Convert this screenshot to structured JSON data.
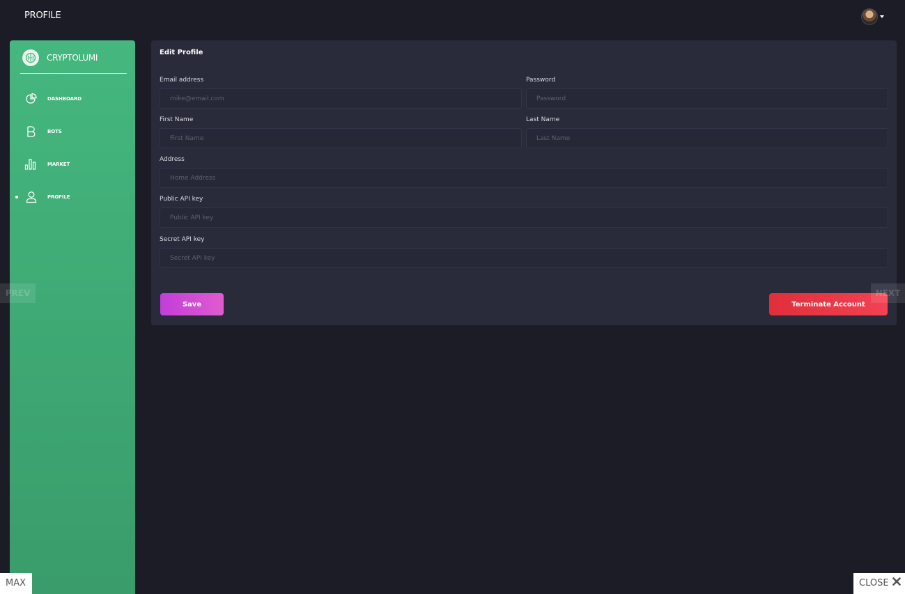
{
  "header": {
    "title": "PROFILE",
    "avatar_icon": "user-avatar-icon"
  },
  "sidebar": {
    "brand_name": "CRYPTOLUMI",
    "brand_icon": "brain-icon",
    "items": [
      {
        "label": "DASHBOARD",
        "icon": "pie-chart-icon",
        "active": false
      },
      {
        "label": "BOTS",
        "icon": "bitcoin-b-icon",
        "active": false
      },
      {
        "label": "MARKET",
        "icon": "bar-chart-icon",
        "active": false
      },
      {
        "label": "PROFILE",
        "icon": "user-icon",
        "active": true
      }
    ]
  },
  "form": {
    "title": "Edit Profile",
    "email": {
      "label": "Email address",
      "placeholder": "mike@email.com",
      "value": ""
    },
    "password": {
      "label": "Password",
      "placeholder": "Password",
      "value": ""
    },
    "first_name": {
      "label": "First Name",
      "placeholder": "First Name",
      "value": ""
    },
    "last_name": {
      "label": "Last Name",
      "placeholder": "Last Name",
      "value": ""
    },
    "address": {
      "label": "Address",
      "placeholder": "Home Address",
      "value": ""
    },
    "public_api_key": {
      "label": "Public API key",
      "placeholder": "Public API key",
      "value": ""
    },
    "secret_api_key": {
      "label": "Secret API key",
      "placeholder": "Secret API key",
      "value": ""
    },
    "save_label": "Save",
    "terminate_label": "Terminate Account"
  },
  "viewer": {
    "prev_label": "PREV",
    "next_label": "NEXT",
    "max_label": "MAX",
    "close_label": "CLOSE",
    "close_icon": "close-x-icon"
  },
  "colors": {
    "background": "#1c1c26",
    "sidebar": "#45b77f",
    "card": "#292b3a",
    "save_button": "#c23ed8",
    "terminate_button": "#e02f3b"
  }
}
